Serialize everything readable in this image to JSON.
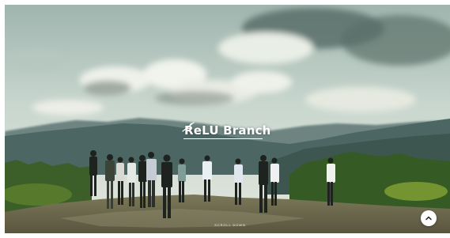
{
  "brand": {
    "logo_text": "ReLU Branch"
  },
  "hero": {
    "scroll_label": "SCROLL DOWN"
  },
  "controls": {
    "scroll_top_icon": "chevron-up-icon"
  },
  "colors": {
    "sky": "#c7d6d0",
    "cloud": "#eef1ea",
    "mountains": "#3f5a57",
    "forest": "#3a5a26",
    "ground": "#6c6a50",
    "button_bg": "#ffffff"
  }
}
